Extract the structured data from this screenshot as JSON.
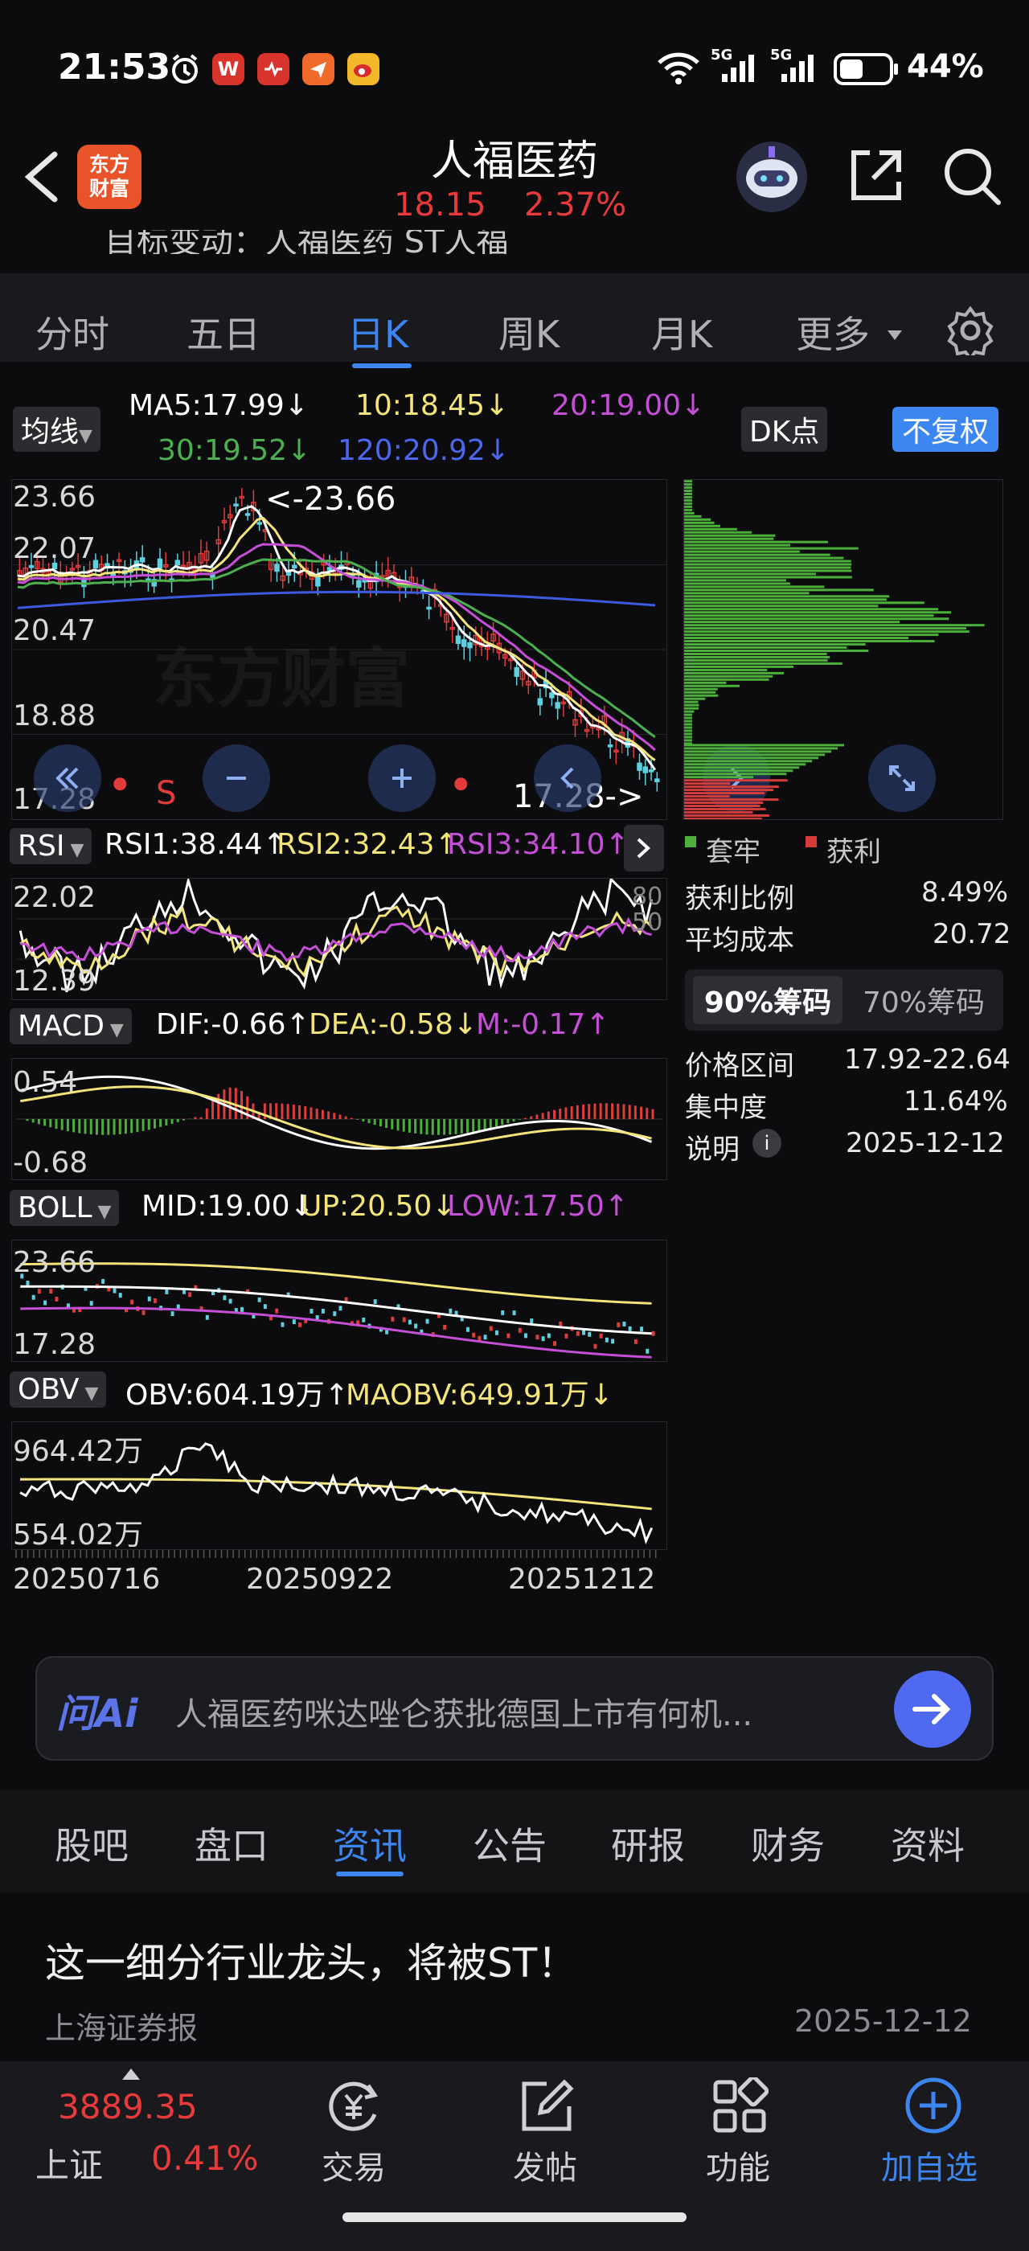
{
  "status_bar": {
    "time": "21:53",
    "battery": "44%",
    "signal_1": "5G",
    "signal_2": "5G",
    "app_icon_labels": [
      "W"
    ]
  },
  "header": {
    "stock_name": "人福医药",
    "price": "18.15",
    "change_pct": "2.37%",
    "logo_line1": "东方",
    "logo_line2": "财富"
  },
  "news_strip": {
    "text": "目标变动：人福医药 ST人福"
  },
  "period_tabs": {
    "items": [
      "分时",
      "五日",
      "日K",
      "周K",
      "月K",
      "更多"
    ],
    "active_index": 2
  },
  "ma_legend": {
    "selector": "均线",
    "ma5": "MA5:17.99↓",
    "ma10": "10:18.45↓",
    "ma20": "20:19.00↓",
    "ma30": "30:19.52↓",
    "ma120": "120:20.92↓",
    "dk_button": "DK点",
    "adjust_button": "不复权"
  },
  "kline": {
    "y_ticks": [
      "23.66",
      "22.07",
      "20.47",
      "18.88",
      "17.28"
    ],
    "high_marker": "<-23.66",
    "low_marker": "17.28->",
    "signal_s": "S",
    "watermark": "东方财富",
    "colors": {
      "up": "#e23b3b",
      "down": "#5fd0e0",
      "ma5": "#ffffff",
      "ma10": "#f3e57a",
      "ma20": "#c64fd8",
      "ma30": "#4caf50",
      "ma120": "#3d5ae0"
    }
  },
  "chip_panel": {
    "legend_locked": "套牢",
    "legend_profit": "获利",
    "rows": [
      {
        "label": "获利比例",
        "value": "8.49%"
      },
      {
        "label": "平均成本",
        "value": "20.72"
      }
    ],
    "tab_90": "90%筹码",
    "tab_70": "70%筹码",
    "rows2": [
      {
        "label": "价格区间",
        "value": "17.92-22.64"
      },
      {
        "label": "集中度",
        "value": "11.64%"
      },
      {
        "label": "说明",
        "value": "2025-12-12"
      }
    ],
    "colors": {
      "locked": "#4caf3c",
      "profit": "#d43b3b"
    }
  },
  "rsi": {
    "selector": "RSI",
    "v1": "RSI1:38.44↑",
    "v2": "RSI2:32.43↑",
    "v3": "RSI3:34.10↑",
    "y_top": "22.02",
    "y_bottom": "12.39",
    "levels": [
      "80",
      "50"
    ]
  },
  "macd": {
    "selector": "MACD",
    "dif": "DIF:-0.66↑",
    "dea": "DEA:-0.58↓",
    "m": "M:-0.17↑",
    "y_top": "0.54",
    "y_bottom": "-0.68"
  },
  "boll": {
    "selector": "BOLL",
    "mid": "MID:19.00↓",
    "up": "UP:20.50↓",
    "low": "LOW:17.50↑",
    "y_top": "23.66",
    "y_bottom": "17.28"
  },
  "obv": {
    "selector": "OBV",
    "obv": "OBV:604.19万↑",
    "maobv": "MAOBV:649.91万↓",
    "y_top": "964.42万",
    "y_bottom": "554.02万"
  },
  "x_axis": {
    "dates": [
      "20250716",
      "20250922",
      "20251212"
    ]
  },
  "ai_bar": {
    "logo": "问Ai",
    "text": "人福医药咪达唑仑获批德国上市有何机..."
  },
  "section_tabs": {
    "items": [
      "股吧",
      "盘口",
      "资讯",
      "公告",
      "研报",
      "财务",
      "资料"
    ],
    "active_index": 2
  },
  "news_item": {
    "title": "这一细分行业龙头，将被ST！",
    "source": "上海证券报",
    "date": "2025-12-12"
  },
  "bottom_nav": {
    "index_value": "3889.35",
    "index_name": "上证",
    "index_change": "0.41%",
    "items": [
      "交易",
      "发帖",
      "功能",
      "加自选"
    ]
  }
}
